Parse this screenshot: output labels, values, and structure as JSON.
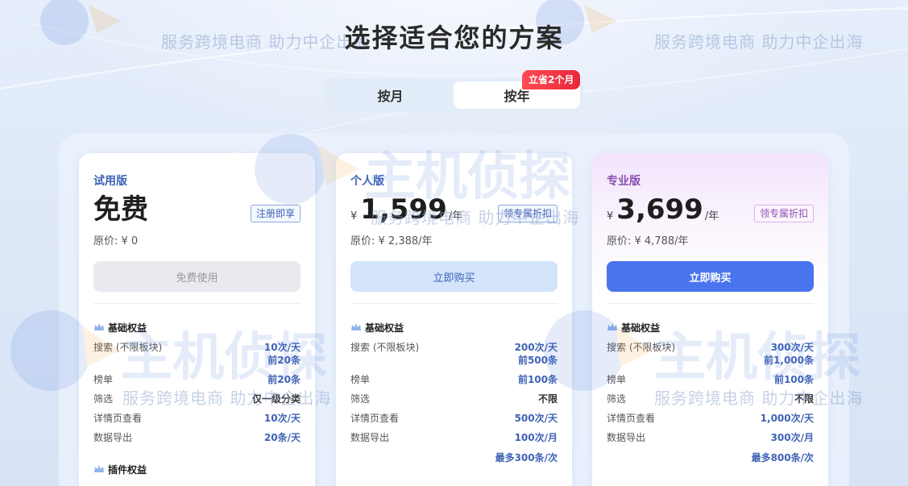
{
  "page": {
    "title": "选择适合您的方案"
  },
  "billing_toggle": {
    "monthly_label": "按月",
    "yearly_label": "按年",
    "selected": "按年",
    "badge": "立省2个月"
  },
  "watermark": {
    "logo_text": "主机侦探",
    "tagline": "服务跨境电商 助力中企出海"
  },
  "plans": [
    {
      "name": "试用版",
      "price_text": "免费",
      "tag_label": "注册即享",
      "original_price": "原价: ¥ 0",
      "button_label": "免费使用",
      "basic_title": "基础权益",
      "rows": [
        {
          "key": "搜索 (不限板块)",
          "value": "10次/天",
          "value2": "前20条"
        },
        {
          "key": "榜单",
          "value": "前20条"
        },
        {
          "key": "筛选",
          "value": "仅一级分类"
        },
        {
          "key": "详情页查看",
          "value": "10次/天"
        },
        {
          "key": "数据导出",
          "value": "20条/天"
        }
      ],
      "plugin_title": "插件权益"
    },
    {
      "name": "个人版",
      "currency": "¥",
      "amount": "1,599",
      "unit": "/年",
      "tag_label": "领专属折扣",
      "original_price": "原价: ¥ 2,388/年",
      "button_label": "立即购买",
      "basic_title": "基础权益",
      "rows": [
        {
          "key": "搜索 (不限板块)",
          "value": "200次/天",
          "value2": "前500条"
        },
        {
          "key": "榜单",
          "value": "前100条"
        },
        {
          "key": "筛选",
          "value": "不限"
        },
        {
          "key": "详情页查看",
          "value": "500次/天"
        },
        {
          "key": "数据导出",
          "value": "100次/月"
        }
      ],
      "extra": "最多300条/次"
    },
    {
      "name": "专业版",
      "currency": "¥",
      "amount": "3,699",
      "unit": "/年",
      "tag_label": "领专属折扣",
      "original_price": "原价: ¥ 4,788/年",
      "button_label": "立即购买",
      "basic_title": "基础权益",
      "rows": [
        {
          "key": "搜索 (不限板块)",
          "value": "300次/天",
          "value2": "前1,000条"
        },
        {
          "key": "榜单",
          "value": "前100条"
        },
        {
          "key": "筛选",
          "value": "不限"
        },
        {
          "key": "详情页查看",
          "value": "1,000次/天"
        },
        {
          "key": "数据导出",
          "value": "300次/月"
        }
      ],
      "extra": "最多800条/次"
    }
  ]
}
